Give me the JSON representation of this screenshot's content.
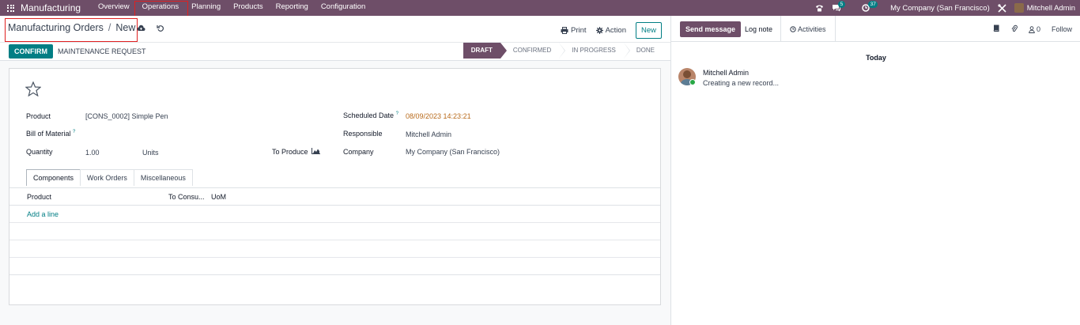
{
  "navbar": {
    "brand": "Manufacturing",
    "menu": [
      "Overview",
      "Operations",
      "Planning",
      "Products",
      "Reporting",
      "Configuration"
    ],
    "highlighted_menu": "Operations",
    "messages_badge": "5",
    "activities_badge": "37",
    "company": "My Company (San Francisco)",
    "user": "Mitchell Admin",
    "colors": {
      "navbar_bg": "#6e4e68",
      "accent": "#017e84"
    }
  },
  "control_panel": {
    "breadcrumb_parent": "Manufacturing Orders",
    "breadcrumb_sep": "/",
    "breadcrumb_current": "New",
    "print_label": "Print",
    "action_label": "Action",
    "new_label": "New",
    "confirm_label": "CONFIRM",
    "maintenance_label": "MAINTENANCE REQUEST",
    "stages": [
      "DRAFT",
      "CONFIRMED",
      "IN PROGRESS",
      "DONE"
    ],
    "active_stage": "DRAFT"
  },
  "form": {
    "product_label": "Product",
    "product_value": "[CONS_0002] Simple Pen",
    "bom_label": "Bill of Material",
    "bom_help": "?",
    "quantity_label": "Quantity",
    "quantity_value": "1.00",
    "quantity_uom": "Units",
    "to_produce_label": "To Produce",
    "scheduled_label": "Scheduled Date",
    "scheduled_help": "?",
    "scheduled_value": "08/09/2023 14:23:21",
    "responsible_label": "Responsible",
    "responsible_value": "Mitchell Admin",
    "company_label": "Company",
    "company_value": "My Company (San Francisco)"
  },
  "tabs": [
    "Components",
    "Work Orders",
    "Miscellaneous"
  ],
  "components_table": {
    "headers": [
      "Product",
      "To Consu...",
      "UoM"
    ],
    "add_line": "Add a line"
  },
  "chatter": {
    "send_message": "Send message",
    "log_note": "Log note",
    "activities": "Activities",
    "followers_count": "0",
    "follow_label": "Follow",
    "date_separator": "Today",
    "message_author": "Mitchell Admin",
    "message_body": "Creating a new record..."
  }
}
